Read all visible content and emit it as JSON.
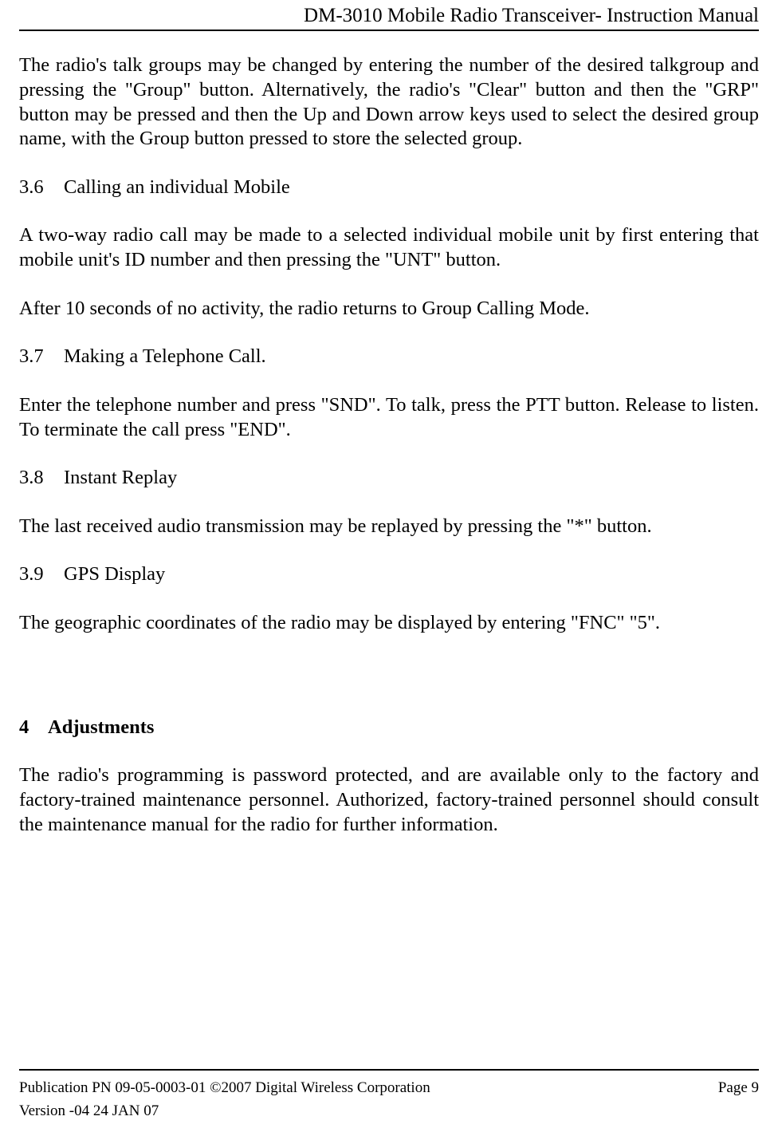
{
  "header": {
    "title": "DM-3010 Mobile Radio Transceiver- Instruction Manual"
  },
  "content": {
    "intro_para": "The radio's talk groups may be changed by entering the number of the desired talkgroup and pressing the \"Group\" button. Alternatively, the radio's \"Clear\" button and then the \"GRP\" button may be pressed and then the Up and Down arrow keys used to select the desired group name, with the Group button pressed to store the selected group.",
    "s36": {
      "num": "3.6",
      "title": "Calling an individual Mobile",
      "p1": "A two-way radio call may be made to a selected individual mobile unit by first entering that mobile unit's ID number and then pressing the \"UNT\" button.",
      "p2": "After 10 seconds of no activity, the radio returns to Group Calling Mode."
    },
    "s37": {
      "num": "3.7",
      "title": "Making a Telephone Call.",
      "p1": "Enter the telephone number and press \"SND\". To talk, press the PTT button. Release to listen. To terminate the call press \"END\"."
    },
    "s38": {
      "num": "3.8",
      "title": "Instant Replay",
      "p1": "The last received audio transmission may be replayed by pressing the \"*\" button."
    },
    "s39": {
      "num": "3.9",
      "title": "GPS Display",
      "p1": "The geographic coordinates of the radio may be displayed by entering \"FNC\" \"5\"."
    },
    "chapter4": {
      "num": "4",
      "title": "Adjustments",
      "p1": "The radio's programming is password protected, and are available only to the factory and factory-trained maintenance personnel. Authorized, factory-trained personnel should consult the maintenance manual for the radio for further information."
    }
  },
  "footer": {
    "publication": "Publication PN 09-05-0003-01 ©2007 Digital Wireless Corporation",
    "page": "Page 9",
    "version": "Version -04 24 JAN 07"
  }
}
